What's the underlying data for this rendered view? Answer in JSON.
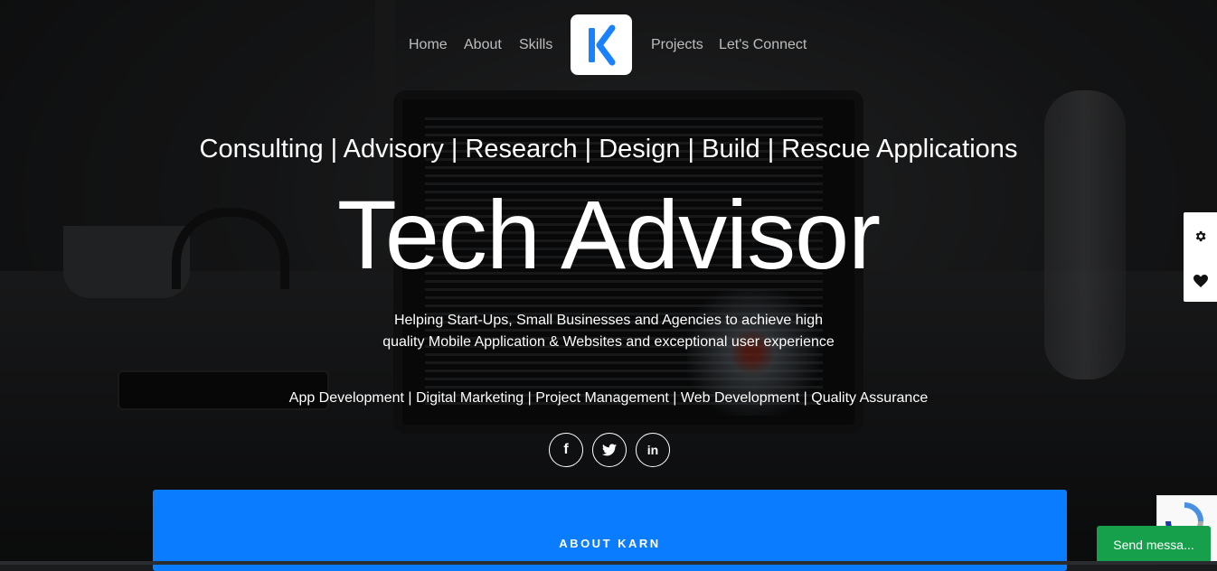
{
  "nav": {
    "items": [
      {
        "label": "Home"
      },
      {
        "label": "About"
      },
      {
        "label": "Skills"
      },
      {
        "label": "Projects"
      },
      {
        "label": "Let's Connect"
      }
    ]
  },
  "hero": {
    "services": "Consulting | Advisory | Research | Design | Build | Rescue Applications",
    "title": "Tech Advisor",
    "tagline": "Helping Start-Ups, Small Businesses and Agencies to achieve high quality Mobile Application & Websites and exceptional user experience",
    "specialties": "App Development | Digital Marketing | Project Management | Web Development | Quality Assurance"
  },
  "social": [
    {
      "icon": "facebook-icon",
      "glyph": "f"
    },
    {
      "icon": "twitter-icon"
    },
    {
      "icon": "linkedin-icon",
      "glyph": "in"
    }
  ],
  "side_toolbar": [
    {
      "icon": "gear-icon"
    },
    {
      "icon": "heart-icon"
    }
  ],
  "about": {
    "label": "ABOUT KARN"
  },
  "chat": {
    "label": "Send messa..."
  },
  "colors": {
    "accent": "#0a7cff",
    "logo_blue": "#1a82ff",
    "chat_green": "#16a04b"
  }
}
